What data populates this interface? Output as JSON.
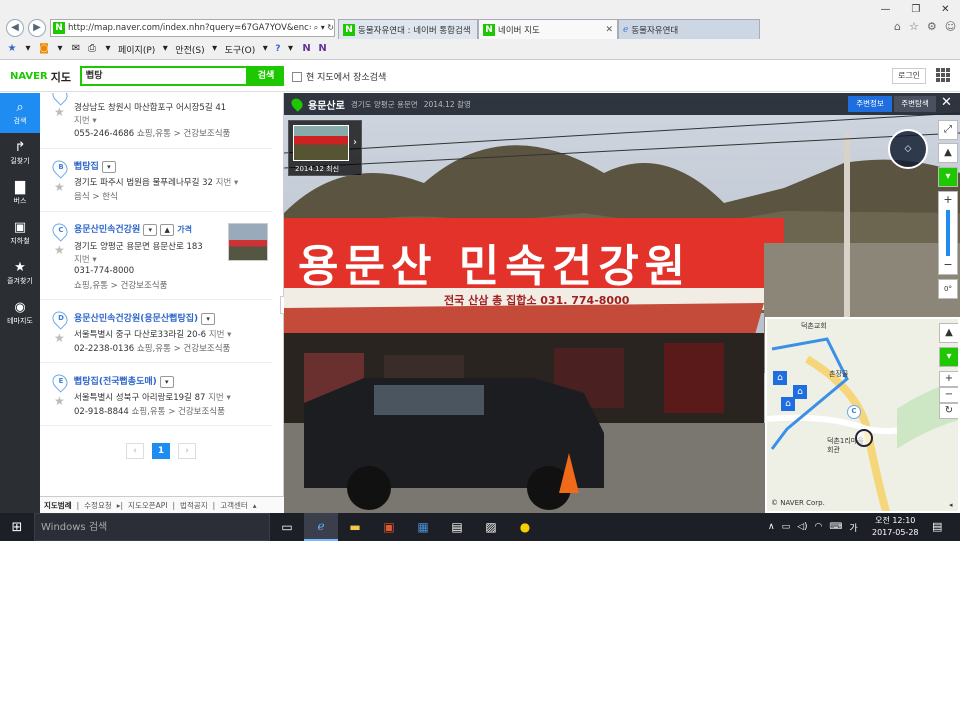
{
  "browser": {
    "url": "http://map.naver.com/index.nhn?query=67GA7YOV&enc=b",
    "tabs": [
      {
        "label": "동물자유연대 : 네이버 통합검색"
      },
      {
        "label": "네이버 지도"
      },
      {
        "label": "동물자유연대"
      }
    ],
    "menu": {
      "page": "페이지(P)",
      "safety": "안전(S)",
      "tools": "도구(O)",
      "help": "?"
    },
    "window_controls": {
      "minimize": "—",
      "restore": "❐",
      "close": "✕"
    }
  },
  "header": {
    "brand": "NAVER",
    "product": "지도",
    "query": "뻡탕",
    "search_button": "검색",
    "here_search": "현 지도에서 장소검색",
    "login": "로그인"
  },
  "left_nav": [
    {
      "label": "검색",
      "icon": "search-icon"
    },
    {
      "label": "길찾기",
      "icon": "directions-icon"
    },
    {
      "label": "버스",
      "icon": "bus-icon"
    },
    {
      "label": "지하철",
      "icon": "subway-icon"
    },
    {
      "label": "즐겨찾기",
      "icon": "star-icon"
    },
    {
      "label": "테마지도",
      "icon": "pin-icon"
    }
  ],
  "results": [
    {
      "marker": "A",
      "name": "",
      "address": "경상남도 창원시 마산합포구 어시장5길 41",
      "detail": "지번",
      "phone": "055-246-4686",
      "category": "쇼핑,유통 > 건강보조식품",
      "price_link": ""
    },
    {
      "marker": "B",
      "name": "뻡탕집",
      "address": "경기도 파주시 법원읍 물푸레나무길 32",
      "detail": "지번",
      "phone": "",
      "category": "음식 > 한식",
      "price_link": ""
    },
    {
      "marker": "C",
      "name": "용문산민속건강원",
      "address": "경기도 양평군 용문면 용문산로 183",
      "detail": "지번",
      "phone": "031-774-8000",
      "category": "쇼핑,유통 > 건강보조식품",
      "price_link": "가격"
    },
    {
      "marker": "D",
      "name": "용문산민속건강원(용문산뻡탕집)",
      "address": "서울특별시 중구 다산로33라길 20-6",
      "detail": "지번",
      "phone": "02-2238-0136",
      "category": "쇼핑,유통 > 건강보조식품",
      "price_link": ""
    },
    {
      "marker": "E",
      "name": "뻡탕집(전국뻡총도매)",
      "address": "서울특별시 성북구 아리랑로19길 87",
      "detail": "지번",
      "phone": "02-918-8844",
      "category": "쇼핑,유통 > 건강보조식품",
      "price_link": ""
    }
  ],
  "pager": {
    "prev": "‹",
    "current": "1",
    "next": "›"
  },
  "footer": [
    "지도범례",
    "수정요청",
    "지도오픈API",
    "법적공지",
    "고객센터"
  ],
  "streetview": {
    "title": "용문산로",
    "address": "경기도 양평군 용문면",
    "date": "2014.12 촬영",
    "thumb_date": "2014.12 최신",
    "nearby_info": "주변정보",
    "nearby_search": "주변탐색",
    "sign_main": "용문산 민속건강원",
    "sign_sub": "전국 산삼 총 집합소   031. 774-8000",
    "minimap_labels": [
      "덕촌교회",
      "촌장골",
      "덕촌1리마을회관"
    ],
    "minimap_marker": "C",
    "copyright": "© NAVER Corp."
  },
  "taskbar": {
    "search_placeholder": "Windows 검색",
    "time": "오전 12:10",
    "date": "2017-05-28",
    "ime": "가"
  }
}
